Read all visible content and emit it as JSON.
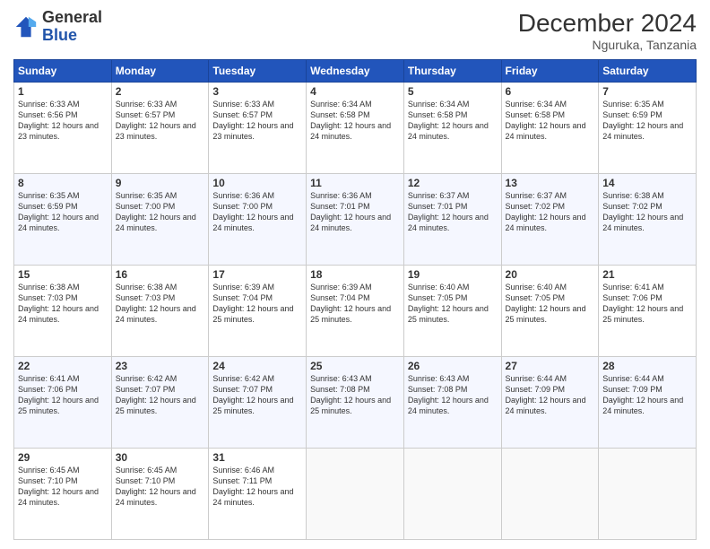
{
  "logo": {
    "line1": "General",
    "line2": "Blue"
  },
  "title": "December 2024",
  "location": "Nguruka, Tanzania",
  "days_header": [
    "Sunday",
    "Monday",
    "Tuesday",
    "Wednesday",
    "Thursday",
    "Friday",
    "Saturday"
  ],
  "weeks": [
    [
      {
        "day": "1",
        "sunrise": "6:33 AM",
        "sunset": "6:56 PM",
        "daylight": "12 hours and 23 minutes."
      },
      {
        "day": "2",
        "sunrise": "6:33 AM",
        "sunset": "6:57 PM",
        "daylight": "12 hours and 23 minutes."
      },
      {
        "day": "3",
        "sunrise": "6:33 AM",
        "sunset": "6:57 PM",
        "daylight": "12 hours and 23 minutes."
      },
      {
        "day": "4",
        "sunrise": "6:34 AM",
        "sunset": "6:58 PM",
        "daylight": "12 hours and 24 minutes."
      },
      {
        "day": "5",
        "sunrise": "6:34 AM",
        "sunset": "6:58 PM",
        "daylight": "12 hours and 24 minutes."
      },
      {
        "day": "6",
        "sunrise": "6:34 AM",
        "sunset": "6:58 PM",
        "daylight": "12 hours and 24 minutes."
      },
      {
        "day": "7",
        "sunrise": "6:35 AM",
        "sunset": "6:59 PM",
        "daylight": "12 hours and 24 minutes."
      }
    ],
    [
      {
        "day": "8",
        "sunrise": "6:35 AM",
        "sunset": "6:59 PM",
        "daylight": "12 hours and 24 minutes."
      },
      {
        "day": "9",
        "sunrise": "6:35 AM",
        "sunset": "7:00 PM",
        "daylight": "12 hours and 24 minutes."
      },
      {
        "day": "10",
        "sunrise": "6:36 AM",
        "sunset": "7:00 PM",
        "daylight": "12 hours and 24 minutes."
      },
      {
        "day": "11",
        "sunrise": "6:36 AM",
        "sunset": "7:01 PM",
        "daylight": "12 hours and 24 minutes."
      },
      {
        "day": "12",
        "sunrise": "6:37 AM",
        "sunset": "7:01 PM",
        "daylight": "12 hours and 24 minutes."
      },
      {
        "day": "13",
        "sunrise": "6:37 AM",
        "sunset": "7:02 PM",
        "daylight": "12 hours and 24 minutes."
      },
      {
        "day": "14",
        "sunrise": "6:38 AM",
        "sunset": "7:02 PM",
        "daylight": "12 hours and 24 minutes."
      }
    ],
    [
      {
        "day": "15",
        "sunrise": "6:38 AM",
        "sunset": "7:03 PM",
        "daylight": "12 hours and 24 minutes."
      },
      {
        "day": "16",
        "sunrise": "6:38 AM",
        "sunset": "7:03 PM",
        "daylight": "12 hours and 24 minutes."
      },
      {
        "day": "17",
        "sunrise": "6:39 AM",
        "sunset": "7:04 PM",
        "daylight": "12 hours and 25 minutes."
      },
      {
        "day": "18",
        "sunrise": "6:39 AM",
        "sunset": "7:04 PM",
        "daylight": "12 hours and 25 minutes."
      },
      {
        "day": "19",
        "sunrise": "6:40 AM",
        "sunset": "7:05 PM",
        "daylight": "12 hours and 25 minutes."
      },
      {
        "day": "20",
        "sunrise": "6:40 AM",
        "sunset": "7:05 PM",
        "daylight": "12 hours and 25 minutes."
      },
      {
        "day": "21",
        "sunrise": "6:41 AM",
        "sunset": "7:06 PM",
        "daylight": "12 hours and 25 minutes."
      }
    ],
    [
      {
        "day": "22",
        "sunrise": "6:41 AM",
        "sunset": "7:06 PM",
        "daylight": "12 hours and 25 minutes."
      },
      {
        "day": "23",
        "sunrise": "6:42 AM",
        "sunset": "7:07 PM",
        "daylight": "12 hours and 25 minutes."
      },
      {
        "day": "24",
        "sunrise": "6:42 AM",
        "sunset": "7:07 PM",
        "daylight": "12 hours and 25 minutes."
      },
      {
        "day": "25",
        "sunrise": "6:43 AM",
        "sunset": "7:08 PM",
        "daylight": "12 hours and 25 minutes."
      },
      {
        "day": "26",
        "sunrise": "6:43 AM",
        "sunset": "7:08 PM",
        "daylight": "12 hours and 24 minutes."
      },
      {
        "day": "27",
        "sunrise": "6:44 AM",
        "sunset": "7:09 PM",
        "daylight": "12 hours and 24 minutes."
      },
      {
        "day": "28",
        "sunrise": "6:44 AM",
        "sunset": "7:09 PM",
        "daylight": "12 hours and 24 minutes."
      }
    ],
    [
      {
        "day": "29",
        "sunrise": "6:45 AM",
        "sunset": "7:10 PM",
        "daylight": "12 hours and 24 minutes."
      },
      {
        "day": "30",
        "sunrise": "6:45 AM",
        "sunset": "7:10 PM",
        "daylight": "12 hours and 24 minutes."
      },
      {
        "day": "31",
        "sunrise": "6:46 AM",
        "sunset": "7:11 PM",
        "daylight": "12 hours and 24 minutes."
      },
      null,
      null,
      null,
      null
    ]
  ]
}
